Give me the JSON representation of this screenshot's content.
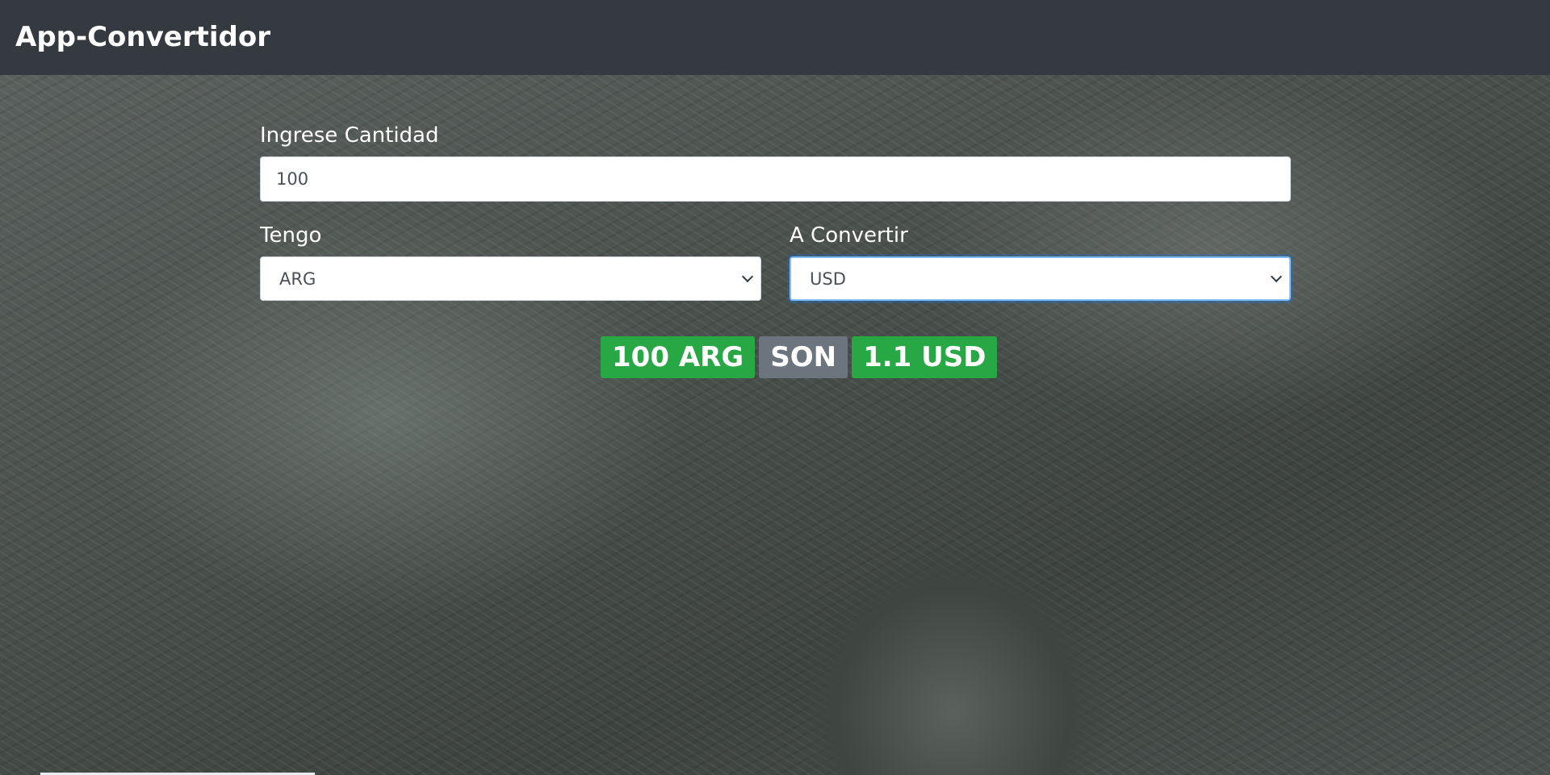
{
  "navbar": {
    "brand": "App-Convertidor"
  },
  "form": {
    "amount_label": "Ingrese Cantidad",
    "amount_value": "100",
    "from_label": "Tengo",
    "from_selected": "ARG",
    "to_label": "A Convertir",
    "to_selected": "USD"
  },
  "result": {
    "from_text": "100 ARG",
    "connector": "SON",
    "to_text": "1.1 USD"
  },
  "colors": {
    "navbar_bg": "#343a40",
    "badge_success": "#28a745",
    "badge_secondary": "#6c757d",
    "focus_border": "#80bdff"
  },
  "icons": {
    "select_arrow": "chevron-down-icon"
  }
}
